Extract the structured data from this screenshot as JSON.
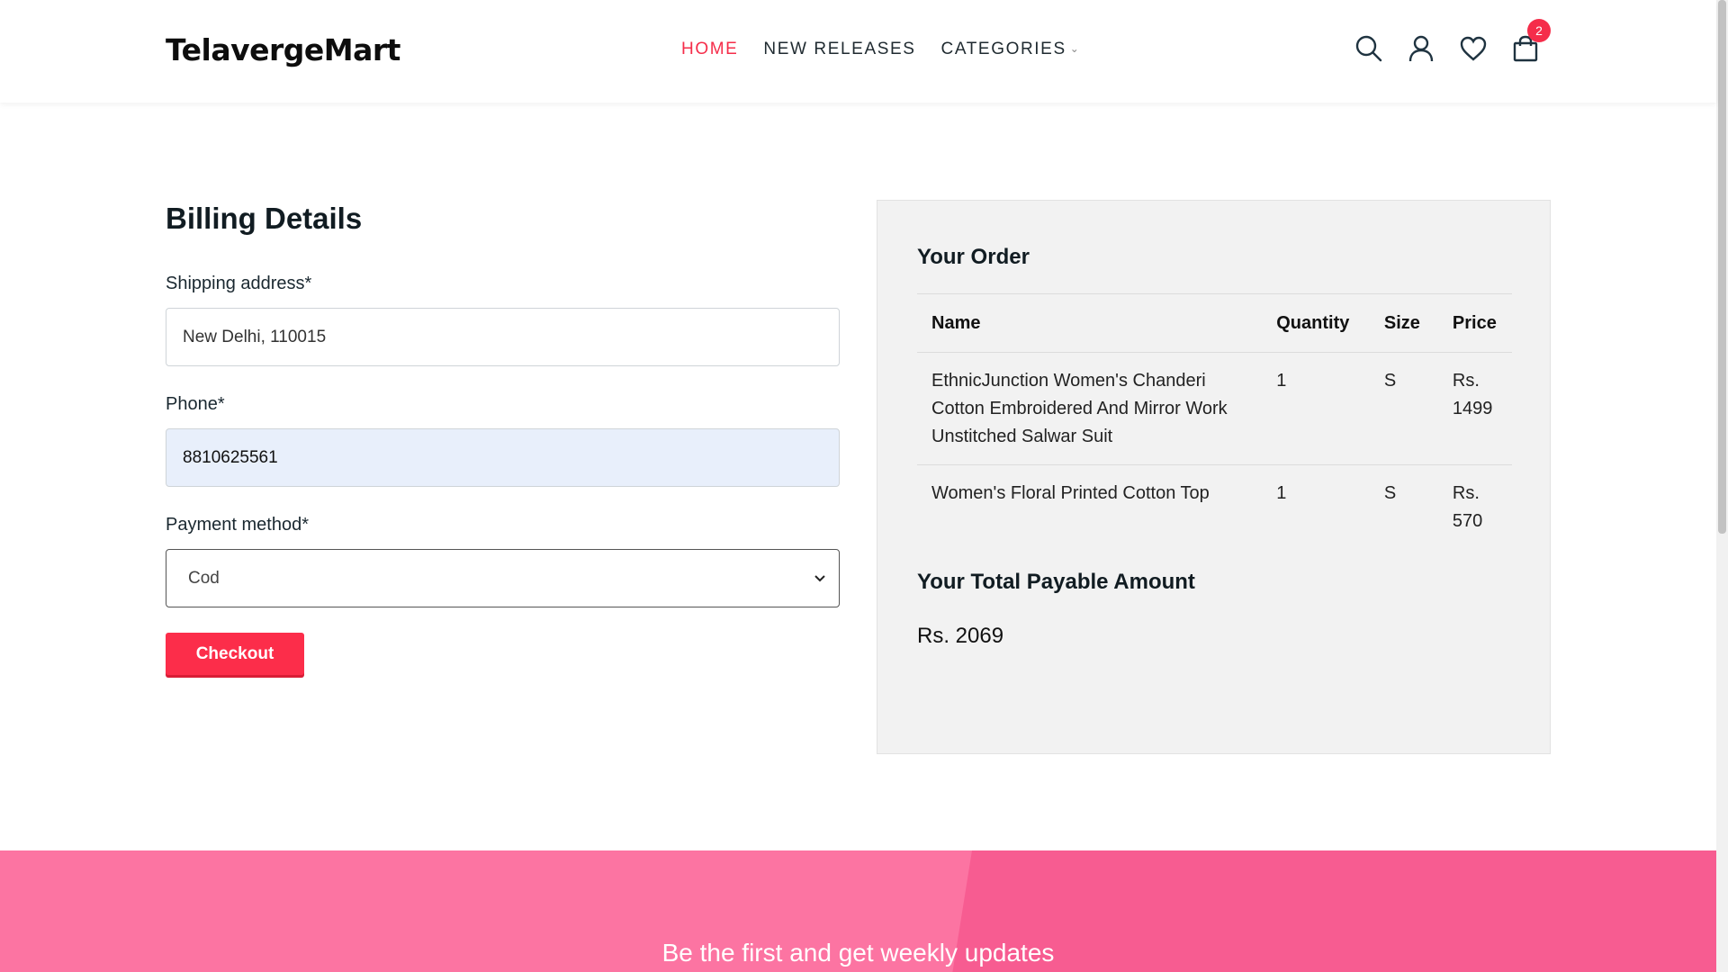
{
  "header": {
    "logo": "TelavergeMart",
    "nav": [
      {
        "label": "HOME",
        "active": true
      },
      {
        "label": "NEW RELEASES",
        "active": false
      },
      {
        "label": "CATEGORIES",
        "active": false
      }
    ],
    "cart_count": "2",
    "icons": [
      "search-icon",
      "user-icon",
      "heart-icon",
      "cart-icon"
    ],
    "accent_color": "#f52d4a"
  },
  "billing": {
    "title": "Billing Details",
    "shipping_label": "Shipping address*",
    "shipping_value": "New Delhi, 110015",
    "phone_label": "Phone*",
    "phone_value": "8810625561",
    "payment_label": "Payment method*",
    "payment_value": "Cod",
    "checkout_label": "Checkout"
  },
  "order": {
    "title": "Your Order",
    "columns": [
      "Name",
      "Quantity",
      "Size",
      "Price"
    ],
    "rows": [
      {
        "name": "EthnicJunction Women's Chanderi Cotton Embroidered And Mirror Work Unstitched Salwar Suit",
        "qty": "1",
        "size": "S",
        "price": "Rs. 1499"
      },
      {
        "name": "Women's Floral Printed Cotton Top",
        "qty": "1",
        "size": "S",
        "price": "Rs. 570"
      }
    ],
    "total_label": "Your Total Payable Amount",
    "total_value": "Rs. 2069"
  },
  "newsletter": {
    "text": "Be the first and get weekly updates"
  }
}
